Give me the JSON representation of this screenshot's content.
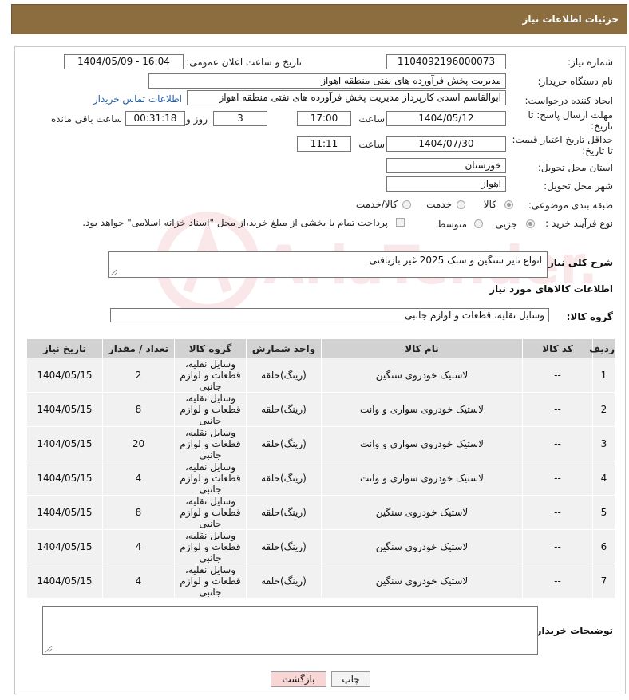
{
  "header": {
    "title": "جزئیات اطلاعات نیاز"
  },
  "form": {
    "need_number_label": "شماره نیاز:",
    "need_number": "1104092196000073",
    "announce_label": "تاریخ و ساعت اعلان عمومی:",
    "announce_value": "1404/05/09 - 16:04",
    "buyer_org_label": "نام دستگاه خریدار:",
    "buyer_org": "مدیریت پخش فرآورده های نفتی منطقه اهواز",
    "creator_label": "ایجاد کننده درخواست:",
    "creator": "ابوالقاسم اسدی کارپرداز مدیریت پخش فرآورده های نفتی منطقه اهواز",
    "contact_link": "اطلاعات تماس خریدار",
    "reply_deadline_label_1": "مهلت ارسال پاسخ: تا",
    "reply_deadline_label_2": "تاریخ:",
    "reply_date": "1404/05/12",
    "time_label": "ساعت",
    "reply_time": "17:00",
    "days_value": "3",
    "days_label": "روز و",
    "remaining_value": "00:31:18",
    "remaining_label": "ساعت باقی مانده",
    "price_deadline_label_1": "حداقل تاریخ اعتبار قیمت:",
    "price_deadline_label_2": "تا تاریخ:",
    "price_date": "1404/07/30",
    "price_time": "11:11",
    "province_label": "استان محل تحویل:",
    "province": "خوزستان",
    "city_label": "شهر محل تحویل:",
    "city": "اهواز",
    "category_label": "طبقه بندی موضوعی:",
    "category_options": [
      "کالا",
      "خدمت",
      "کالا/خدمت"
    ],
    "process_label": "نوع فرآیند خرید :",
    "process_options": [
      "جزیی",
      "متوسط"
    ],
    "payment_note": "پرداخت تمام یا بخشی از مبلغ خرید،از محل \"اسناد خزانه اسلامی\" خواهد بود.",
    "description_label": "شرح کلی نیاز:",
    "description": "انواع تایر سنگین و سبک 2025 غیر بازیافتی",
    "goods_info_title": "اطلاعات کالاهای مورد نیاز",
    "goods_group_label": "گروه کالا:",
    "goods_group": "وسایل نقلیه، قطعات و لوازم جانبی",
    "buyer_notes_label": "توضیحات خریدار:"
  },
  "table": {
    "headers": [
      "ردیف",
      "کد کالا",
      "نام کالا",
      "واحد شمارش",
      "گروه کالا",
      "تعداد / مقدار",
      "تاریخ نیاز"
    ],
    "rows": [
      {
        "row": "1",
        "code": "--",
        "name": "لاستیک خودروی سنگین",
        "unit": "(رینگ)حلقه",
        "group": "وسایل نقلیه، قطعات و لوازم جانبی",
        "qty": "2",
        "date": "1404/05/15"
      },
      {
        "row": "2",
        "code": "--",
        "name": "لاستیک خودروی سواری و وانت",
        "unit": "(رینگ)حلقه",
        "group": "وسایل نقلیه، قطعات و لوازم جانبی",
        "qty": "8",
        "date": "1404/05/15"
      },
      {
        "row": "3",
        "code": "--",
        "name": "لاستیک خودروی سواری و وانت",
        "unit": "(رینگ)حلقه",
        "group": "وسایل نقلیه، قطعات و لوازم جانبی",
        "qty": "20",
        "date": "1404/05/15"
      },
      {
        "row": "4",
        "code": "--",
        "name": "لاستیک خودروی سواری و وانت",
        "unit": "(رینگ)حلقه",
        "group": "وسایل نقلیه، قطعات و لوازم جانبی",
        "qty": "4",
        "date": "1404/05/15"
      },
      {
        "row": "5",
        "code": "--",
        "name": "لاستیک خودروی سنگین",
        "unit": "(رینگ)حلقه",
        "group": "وسایل نقلیه، قطعات و لوازم جانبی",
        "qty": "8",
        "date": "1404/05/15"
      },
      {
        "row": "6",
        "code": "--",
        "name": "لاستیک خودروی سنگین",
        "unit": "(رینگ)حلقه",
        "group": "وسایل نقلیه، قطعات و لوازم جانبی",
        "qty": "4",
        "date": "1404/05/15"
      },
      {
        "row": "7",
        "code": "--",
        "name": "لاستیک خودروی سنگین",
        "unit": "(رینگ)حلقه",
        "group": "وسایل نقلیه، قطعات و لوازم جانبی",
        "qty": "4",
        "date": "1404/05/15"
      }
    ]
  },
  "buttons": {
    "print": "چاپ",
    "back": "بازگشت"
  },
  "watermark": {
    "text": "AriaTender.neT"
  },
  "colors": {
    "header_bg": "#8b6d3f",
    "link": "#1f5ea8",
    "back_button_bg": "#f8d6d6",
    "table_header_bg": "#d2d2d2"
  }
}
